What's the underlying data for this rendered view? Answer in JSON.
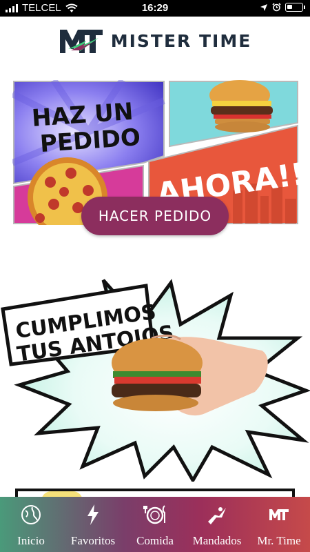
{
  "status_bar": {
    "carrier": "TELCEL",
    "time": "16:29"
  },
  "header": {
    "brand": "MISTER TIME"
  },
  "banner": {
    "headline_line1": "HAZ UN",
    "headline_line2": "PEDIDO",
    "headline_now": "AHORA!!",
    "cta_label": "HACER PEDIDO"
  },
  "promo": {
    "line1": "CUMPLIMOS",
    "line2": "TUS ANTOJOS"
  },
  "tabs": [
    {
      "label": "Inicio",
      "icon": "globe-icon"
    },
    {
      "label": "Favoritos",
      "icon": "lightning-icon"
    },
    {
      "label": "Comida",
      "icon": "plate-icon"
    },
    {
      "label": "Mandados",
      "icon": "runner-icon"
    },
    {
      "label": "Mr. Time",
      "icon": "mt-logo-icon"
    }
  ],
  "colors": {
    "accent": "#8c2e5e",
    "brand_dark": "#1f2d3d",
    "brand_green": "#3ec97a"
  }
}
